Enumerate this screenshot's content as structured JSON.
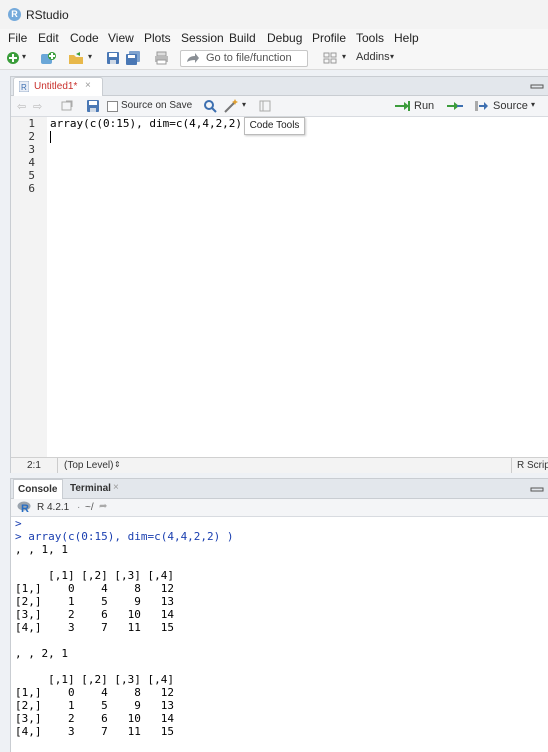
{
  "window": {
    "title": "RStudio",
    "logo": "R"
  },
  "menu": [
    "File",
    "Edit",
    "Code",
    "View",
    "Plots",
    "Session",
    "Build",
    "Debug",
    "Profile",
    "Tools",
    "Help"
  ],
  "toolbar": {
    "goto_placeholder": "Go to file/function",
    "addins_label": "Addins"
  },
  "source": {
    "tab_label": "Untitled1*",
    "source_on_save_label": "Source on Save",
    "run_label": "Run",
    "source_label": "Source",
    "tooltip": "Code Tools",
    "line_numbers": [
      "1",
      "2",
      "3",
      "4",
      "5",
      "6"
    ],
    "code_line1": "array(c(0:15), dim=c(4,4,2,2) )",
    "cursor_position": "2:1",
    "scope": "(Top Level)",
    "file_type": "R Script"
  },
  "console": {
    "tabs": [
      "Console",
      "Terminal"
    ],
    "r_version": "R 4.2.1",
    "working_dir": "~/",
    "prompt_empty": ">",
    "command": "> array(c(0:15), dim=c(4,4,2,2) )",
    "output_lines": [
      ", , 1, 1",
      "",
      "     [,1] [,2] [,3] [,4]",
      "[1,]    0    4    8   12",
      "[2,]    1    5    9   13",
      "[3,]    2    6   10   14",
      "[4,]    3    7   11   15",
      "",
      ", , 2, 1",
      "",
      "     [,1] [,2] [,3] [,4]",
      "[1,]    0    4    8   12",
      "[2,]    1    5    9   13",
      "[3,]    2    6   10   14",
      "[4,]    3    7   11   15"
    ]
  },
  "colors": {
    "accent_blue": "#75aadb",
    "tab_modified_red": "#c9302c",
    "run_green": "#3c9c3c"
  },
  "icons": [
    "new-file-icon",
    "new-project-icon",
    "open-folder-icon",
    "save-icon",
    "save-all-icon",
    "print-icon",
    "goto-arrow-icon",
    "grid-layout-icon",
    "back-arrow-icon",
    "forward-arrow-icon",
    "show-in-window-icon",
    "search-icon",
    "magic-wand-icon",
    "compile-report-icon",
    "run-arrow-icon",
    "rerun-icon",
    "source-icon",
    "minimize-icon",
    "r-logo-icon"
  ]
}
